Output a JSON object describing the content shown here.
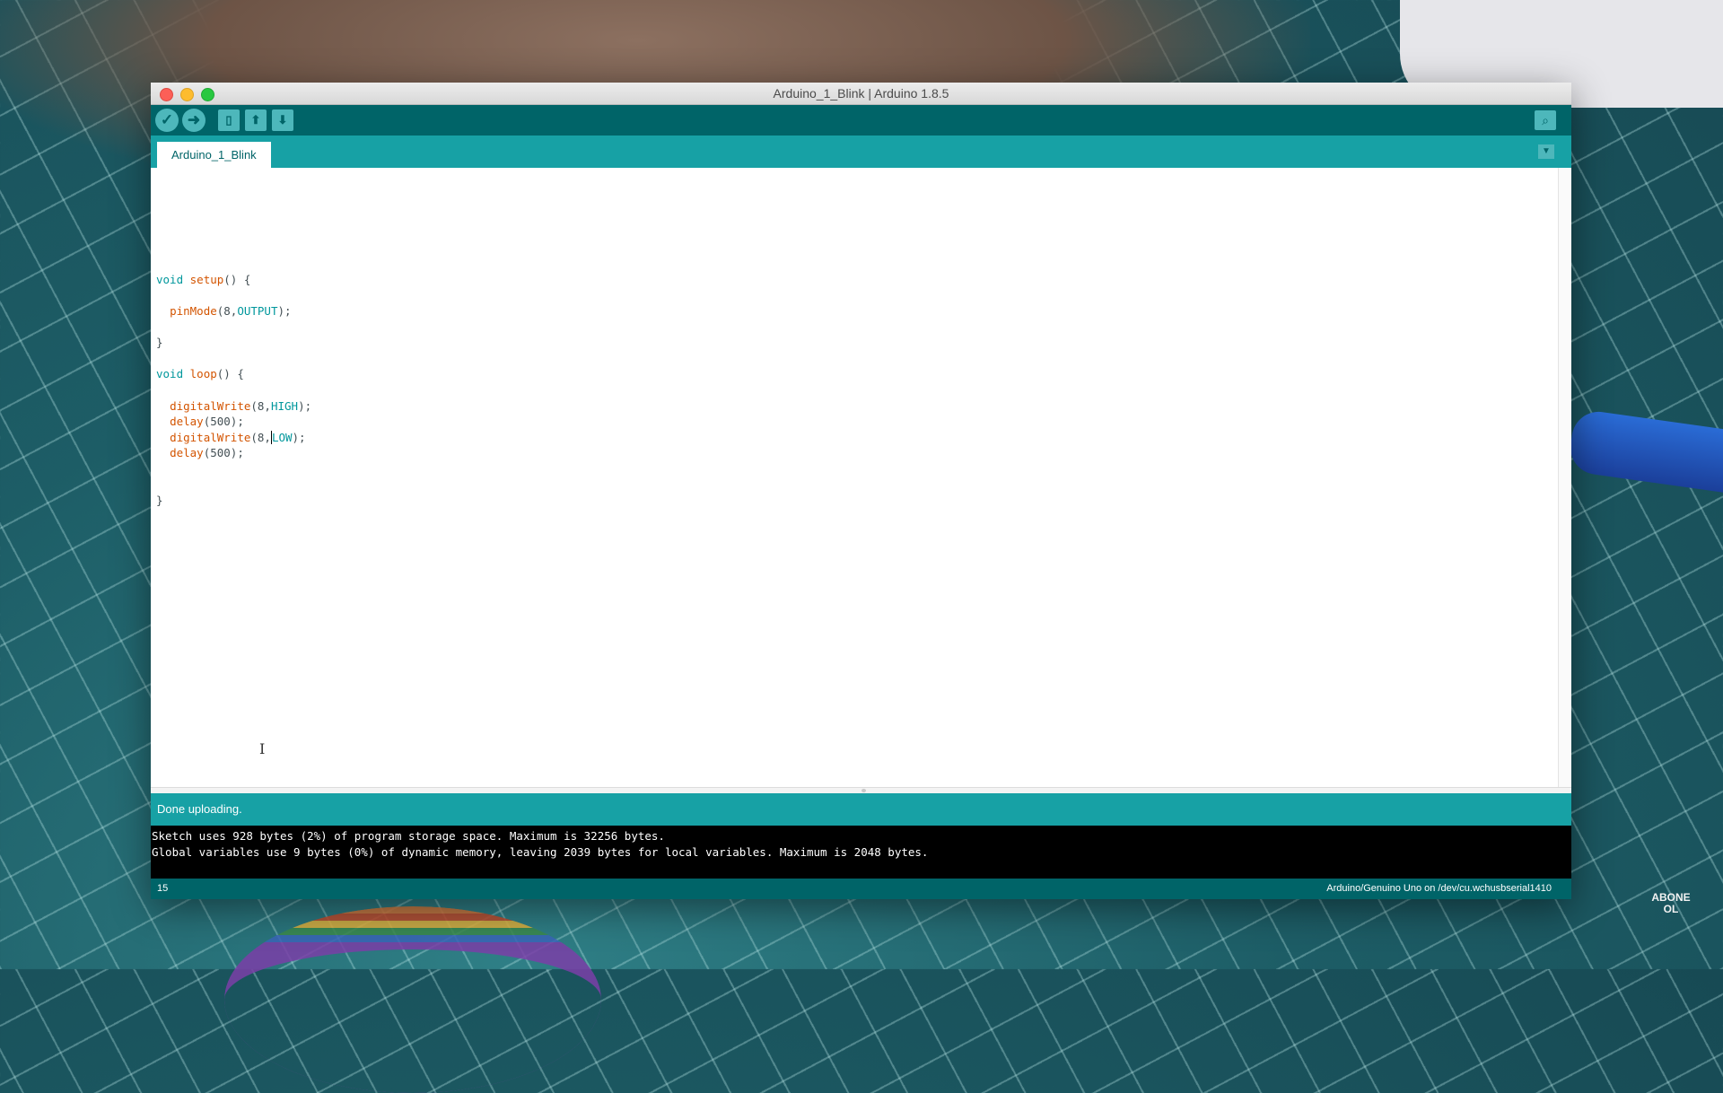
{
  "window": {
    "title": "Arduino_1_Blink | Arduino 1.8.5"
  },
  "toolbar": {
    "buttons": [
      {
        "name": "verify",
        "icon": "check-icon"
      },
      {
        "name": "upload",
        "icon": "arrow-right-icon"
      },
      {
        "name": "new",
        "icon": "new-file-icon"
      },
      {
        "name": "open",
        "icon": "arrow-up-icon"
      },
      {
        "name": "save",
        "icon": "arrow-down-icon"
      },
      {
        "name": "serial-monitor",
        "icon": "magnifier-icon"
      }
    ]
  },
  "tabs": [
    {
      "label": "Arduino_1_Blink",
      "active": true
    }
  ],
  "editor": {
    "lines": [
      "",
      "",
      "",
      "void setup() {",
      "",
      "  pinMode(8,OUTPUT);",
      "",
      "}",
      "",
      "void loop() {",
      "",
      "  digitalWrite(8,HIGH);",
      "  delay(500);",
      "  digitalWrite(8,LOW);",
      "  delay(500);",
      "",
      "",
      "}"
    ],
    "cursor_line": 14
  },
  "status": {
    "message": "Done uploading."
  },
  "console": {
    "lines": [
      "Sketch uses 928 bytes (2%) of program storage space. Maximum is 32256 bytes.",
      "Global variables use 9 bytes (0%) of dynamic memory, leaving 2039 bytes for local variables. Maximum is 2048 bytes."
    ]
  },
  "footer": {
    "line_number": "15",
    "board": "Arduino/Genuino Uno on /dev/cu.wchusbserial1410"
  },
  "overlay": {
    "logo_text": "ABONE OL"
  },
  "colors": {
    "toolbar": "#006468",
    "tabbar": "#17a1a5",
    "keyword": "#00979c",
    "function": "#d35400"
  }
}
